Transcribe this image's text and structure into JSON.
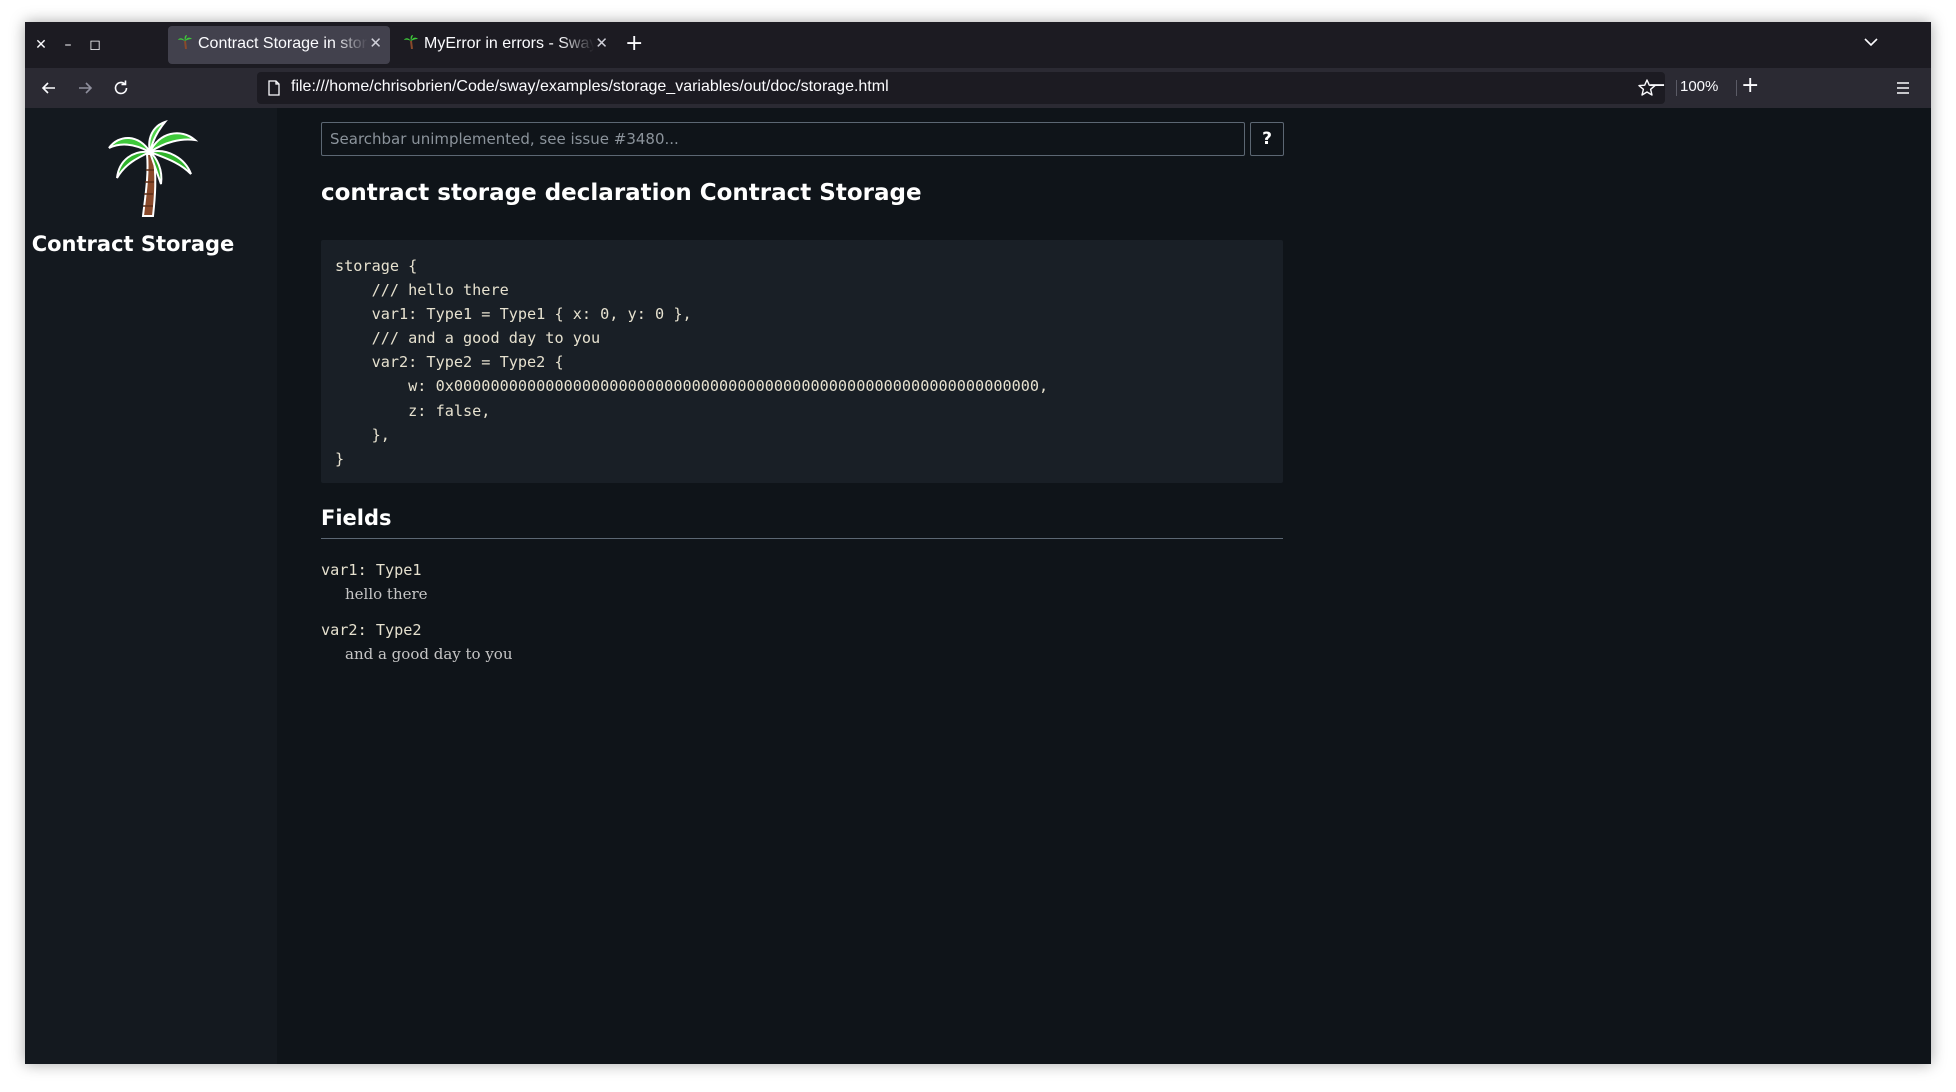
{
  "browser": {
    "tabs": [
      {
        "title": "Contract Storage in storage - Sway",
        "active": true
      },
      {
        "title": "MyError in errors - Sway",
        "active": false
      }
    ],
    "url": "file:///home/chrisobrien/Code/sway/examples/storage_variables/out/doc/storage.html",
    "zoom": "100%"
  },
  "sidebar": {
    "title": "Contract Storage",
    "logo_icon": "palm-tree-icon"
  },
  "search": {
    "placeholder": "Searchbar unimplemented, see issue #3480...",
    "help_label": "?"
  },
  "page": {
    "title": "contract storage declaration Contract Storage",
    "code": "storage {\n    /// hello there\n    var1: Type1 = Type1 { x: 0, y: 0 },\n    /// and a good day to you\n    var2: Type2 = Type2 {\n        w: 0x0000000000000000000000000000000000000000000000000000000000000000,\n        z: false,\n    },\n}",
    "fields_heading": "Fields",
    "fields": [
      {
        "signature": "var1: Type1",
        "doc": "hello there"
      },
      {
        "signature": "var2: Type2",
        "doc": "and a good day to you"
      }
    ]
  },
  "colors": {
    "background": "#0f1419",
    "sidebar": "#14191f",
    "code_bg": "#191f26",
    "palm_leaf": "#3ec93a",
    "palm_trunk": "#8a4a2b"
  }
}
